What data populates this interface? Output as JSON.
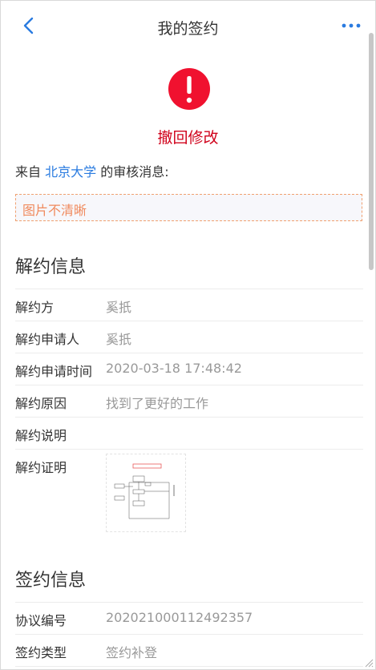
{
  "nav": {
    "title": "我的签约",
    "back_icon": "chevron-left-icon",
    "more_icon": "more-dots-icon"
  },
  "status": {
    "icon": "exclamation-circle-icon",
    "text": "撤回修改",
    "color": "#d0021b"
  },
  "message": {
    "prefix": "来自 ",
    "source": "北京大学",
    "suffix": " 的审核消息:"
  },
  "notice": {
    "text": "图片不清晰"
  },
  "termination": {
    "title": "解约信息",
    "rows": [
      {
        "label": "解约方",
        "value": "奚扺"
      },
      {
        "label": "解约申请人",
        "value": "奚扺"
      },
      {
        "label": "解约申请时间",
        "value": "2020-03-18 17:48:42"
      },
      {
        "label": "解约原因",
        "value": "找到了更好的工作"
      },
      {
        "label": "解约说明",
        "value": ""
      },
      {
        "label": "解约证明",
        "value": ""
      }
    ]
  },
  "signing": {
    "title": "签约信息",
    "rows": [
      {
        "label": "协议编号",
        "value": "202021000112492357"
      },
      {
        "label": "签约类型",
        "value": "签约补登"
      }
    ]
  },
  "colors": {
    "accent": "#2a7be0",
    "status": "#d0021b",
    "notice_text": "#f08a5d"
  }
}
